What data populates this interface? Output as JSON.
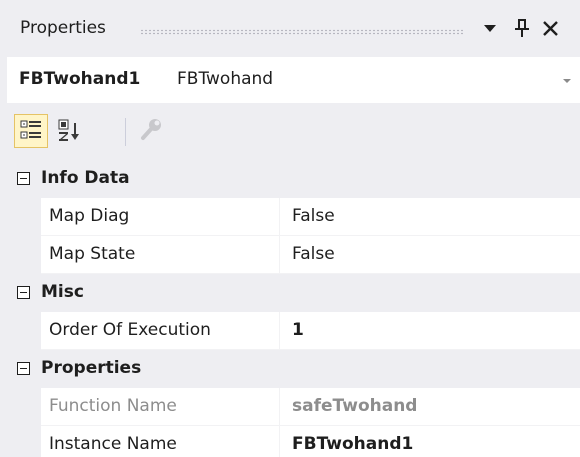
{
  "titlebar": {
    "title": "Properties",
    "dropdown_icon": "dropdown-arrow-icon",
    "pin_icon": "pin-icon",
    "close_icon": "close-icon"
  },
  "selector": {
    "object_name": "FBTwohand1",
    "object_type": "FBTwohand"
  },
  "toolbar": {
    "categorized_icon": "categorized-icon",
    "alphabetical_icon": "alphabetical-sort-icon",
    "property_pages_icon": "wrench-icon"
  },
  "grid": {
    "categories": [
      {
        "label": "Info Data",
        "expanded": true,
        "properties": [
          {
            "name": "Map Diag",
            "value": "False",
            "readonly": false,
            "bold": false
          },
          {
            "name": "Map State",
            "value": "False",
            "readonly": false,
            "bold": false
          }
        ]
      },
      {
        "label": "Misc",
        "expanded": true,
        "properties": [
          {
            "name": "Order Of Execution",
            "value": "1",
            "readonly": false,
            "bold": true
          }
        ]
      },
      {
        "label": "Properties",
        "expanded": true,
        "properties": [
          {
            "name": "Function Name",
            "value": "safeTwohand",
            "readonly": true,
            "bold": true
          },
          {
            "name": "Instance Name",
            "value": "FBTwohand1",
            "readonly": false,
            "bold": true
          }
        ]
      }
    ]
  },
  "colors": {
    "panel_bg": "#eeeef2",
    "grid_bg": "#ffffff",
    "text": "#1e1e1e",
    "readonly_text": "#8d8d8d",
    "selected_tool_bg": "#fff5c8",
    "selected_tool_border": "#e5c365"
  }
}
